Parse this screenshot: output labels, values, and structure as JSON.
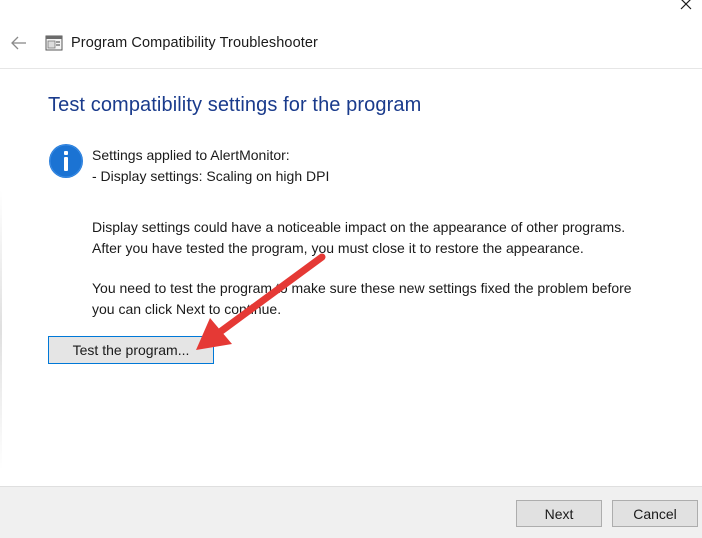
{
  "window": {
    "title": "Program Compatibility Troubleshooter"
  },
  "icons": {
    "close": "close-icon",
    "back": "back-arrow-icon",
    "app": "troubleshooter-app-icon",
    "info": "info-icon",
    "annotation": "red-arrow-annotation"
  },
  "colors": {
    "heading": "#1a3b8c",
    "info_icon": "#1b73d3",
    "focus_border": "#0078d7",
    "annotation_arrow": "#e53935"
  },
  "main": {
    "heading": "Test compatibility settings for the program",
    "settings_line1": "Settings applied to AlertMonitor:",
    "settings_line2": "- Display settings:  Scaling on high DPI",
    "warning_line1": "Display settings could have a noticeable impact on the appearance of other programs.",
    "warning_line2": "After you have tested the program, you must close it to restore the appearance.",
    "instruction_line1": "You need to test the program to make sure these new settings fixed the problem before",
    "instruction_line2": "you can click Next to continue.",
    "test_button_label": "Test the program..."
  },
  "footer": {
    "next_label": "Next",
    "cancel_label": "Cancel"
  }
}
